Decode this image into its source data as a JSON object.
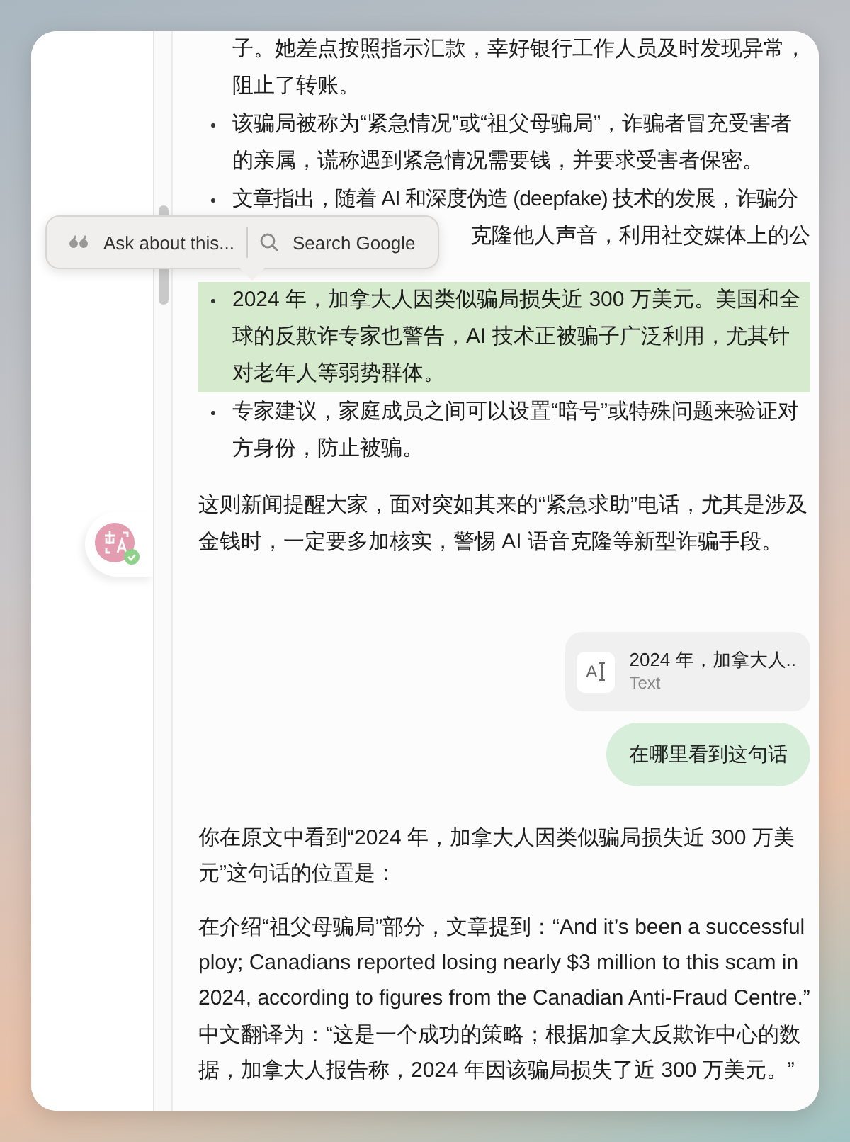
{
  "article": {
    "items": [
      {
        "kind": "continuation",
        "text": "子。她差点按照指示汇款，幸好银行工作人员及时发现异常，阻止了转账。",
        "highlighted": false
      },
      {
        "kind": "bullet",
        "text": "该骗局被称为“紧急情况”或“祖父母骗局”，诈骗者冒充受害者的亲属，谎称遇到紧急情况需要钱，并要求受害者保密。",
        "highlighted": false
      },
      {
        "kind": "covered",
        "text": "文章指出，随着 AI 和深度伪造 (deepfake) 技术的发展，诈骗分",
        "rest": "克隆他人声音，利用社交媒体上的公",
        "highlighted": false
      },
      {
        "kind": "bullet",
        "text": "2024 年，加拿大人因类似骗局损失近 300 万美元。美国和全球的反欺诈专家也警告，AI 技术正被骗子广泛利用，尤其针对老年人等弱势群体。",
        "highlighted": true
      },
      {
        "kind": "bullet",
        "text": "专家建议，家庭成员之间可以设置“暗号”或特殊问题来验证对方身份，防止被骗。",
        "highlighted": false
      }
    ],
    "summary": "这则新闻提醒大家，面对突如其来的“紧急求助”电话，尤其是涉及金钱时，一定要多加核实，警惕 AI 语音克隆等新型诈骗手段。"
  },
  "popup": {
    "actions": [
      {
        "kind": "quote",
        "label": "Ask about this..."
      },
      {
        "kind": "search",
        "label": "Search Google"
      }
    ]
  },
  "attachment": {
    "icon_text": "A",
    "title": "2024 年，加拿大人..",
    "subtitle": "Text"
  },
  "user_message": "在哪里看到这句话",
  "answer": [
    "你在原文中看到“2024 年，加拿大人因类似骗局损失近 300 万美元”这句话的位置是：",
    "在介绍“祖父母骗局”部分，文章提到：“And it’s been a successful ploy; Canadians reported losing nearly $3 million to this scam in 2024, according to figures from the Canadian Anti-Fraud Centre.”",
    "中文翻译为：“这是一个成功的策略；根据加拿大反欺诈中心的数据，加拿大人报告称，2024 年因该骗局损失了近 300 万美元。”"
  ]
}
